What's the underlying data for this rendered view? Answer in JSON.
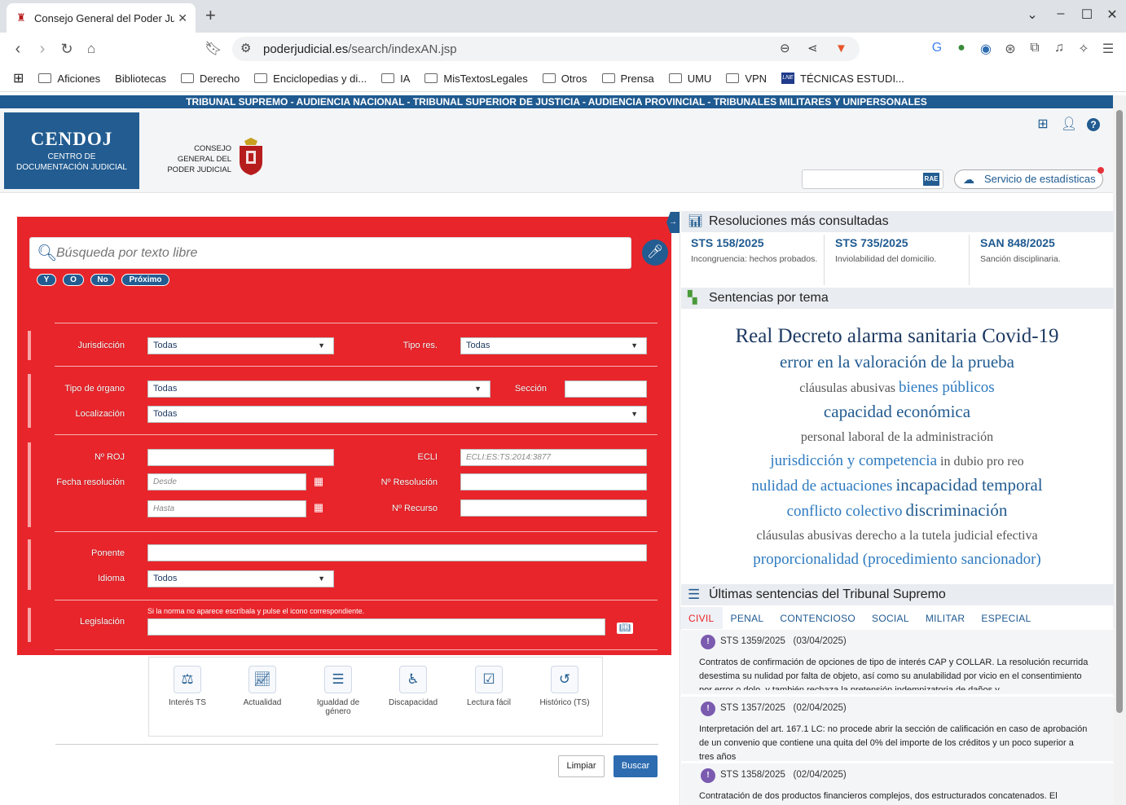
{
  "browser": {
    "tab_title": "Consejo General del Poder Judicial",
    "url_host": "poderjudicial.es",
    "url_path": "/search/indexAN.jsp",
    "bookmarks": [
      "Aficiones",
      "Bibliotecas",
      "Derecho",
      "Enciclopedias y di...",
      "IA",
      "MisTextosLegales",
      "Otros",
      "Prensa",
      "UMU",
      "VPN",
      "TÉCNICAS ESTUDI..."
    ]
  },
  "header": {
    "top_bar": "TRIBUNAL SUPREMO - AUDIENCIA NACIONAL - TRIBUNAL SUPERIOR DE JUSTICIA - AUDIENCIA PROVINCIAL - TRIBUNALES MILITARES Y UNIPERSONALES",
    "cendoj_title": "CENDOJ",
    "cendoj_sub1": "CENTRO DE",
    "cendoj_sub2": "DOCUMENTACIÓN JUDICIAL",
    "cgpj1": "CONSEJO",
    "cgpj2": "GENERAL DEL",
    "cgpj3": "PODER JUDICIAL",
    "rae_label": "RAE",
    "stats_button": "Servicio de estadísticas"
  },
  "search": {
    "placeholder": "Búsqueda por texto libre",
    "operators": [
      "Y",
      "O",
      "No",
      "Próximo"
    ],
    "labels": {
      "jurisdiccion": "Jurisdicción",
      "tipo_res": "Tipo res.",
      "tipo_organo": "Tipo de órgano",
      "seccion": "Sección",
      "localizacion": "Localización",
      "roj": "Nº ROJ",
      "ecli": "ECLI",
      "fecha": "Fecha resolución",
      "n_resolucion": "Nº Resolución",
      "n_recurso": "Nº Recurso",
      "ponente": "Ponente",
      "idioma": "Idioma",
      "legislacion": "Legislación"
    },
    "values": {
      "jurisdiccion": "Todas",
      "tipo_res": "Todas",
      "tipo_organo": "Todas",
      "localizacion": "Todas",
      "idioma": "Todos"
    },
    "placeholders": {
      "ecli": "ECLI:ES:TS:2014:3877",
      "desde": "Desde",
      "hasta": "Hasta"
    },
    "legislacion_note": "Si la norma no aparece escríbala y pulse el icono correspondiente.",
    "quick_filters": [
      "Interés TS",
      "Actualidad",
      "Igualdad de género",
      "Discapacidad",
      "Lectura fácil",
      "Histórico (TS)"
    ],
    "clear_button": "Limpiar",
    "search_button": "Buscar"
  },
  "right": {
    "most_consulted_title": "Resoluciones más consultadas",
    "most_consulted": [
      {
        "id": "STS 158/2025",
        "desc": "Incongruencia: hechos probados."
      },
      {
        "id": "STS 735/2025",
        "desc": "Inviolabilidad del domicilio."
      },
      {
        "id": "SAN 848/2025",
        "desc": "Sanción disciplinaria."
      }
    ],
    "topics_title": "Sentencias por tema",
    "topics": [
      "Real Decreto alarma sanitaria Covid-19",
      "error en la valoración de la prueba",
      "cláusulas abusivas",
      "bienes públicos",
      "capacidad económica",
      "personal laboral de la administración",
      "jurisdicción y competencia",
      "in dubio pro reo",
      "nulidad de actuaciones",
      "incapacidad temporal",
      "conflicto colectivo",
      "discriminación",
      "cláusulas abusivas",
      "derecho a la tutela judicial efectiva",
      "proporcionalidad (procedimiento sancionador)"
    ],
    "latest_title": "Últimas sentencias del Tribunal Supremo",
    "latest_tabs": [
      "CIVIL",
      "PENAL",
      "CONTENCIOSO",
      "SOCIAL",
      "MILITAR",
      "ESPECIAL"
    ],
    "latest": [
      {
        "id": "STS 1359/2025",
        "date": "(03/04/2025)",
        "text": "Contratos de confirmación de opciones de tipo de interés CAP y COLLAR. La resolución recurrida desestima su nulidad por falta de objeto, así como su anulabilidad por vicio en el consentimiento por error o dolo, y también rechaza la pretensión indemnizatoria de daños y"
      },
      {
        "id": "STS 1357/2025",
        "date": "(02/04/2025)",
        "text": "Interpretación del art. 167.1 LC: no procede abrir la sección de calificación en caso de aprobación de un convenio que contiene una quita del 0% del importe de los créditos y un poco superior a tres años"
      },
      {
        "id": "STS 1358/2025",
        "date": "(02/04/2025)",
        "text": "Contratación de dos productos financieros complejos, dos estructurados concatenados. El segundo suponía la cancelación o reestructuración del primero. El comienzo del plazo de"
      }
    ]
  },
  "colors": {
    "form_red": "#e8252b",
    "brand_blue": "#225c91"
  }
}
